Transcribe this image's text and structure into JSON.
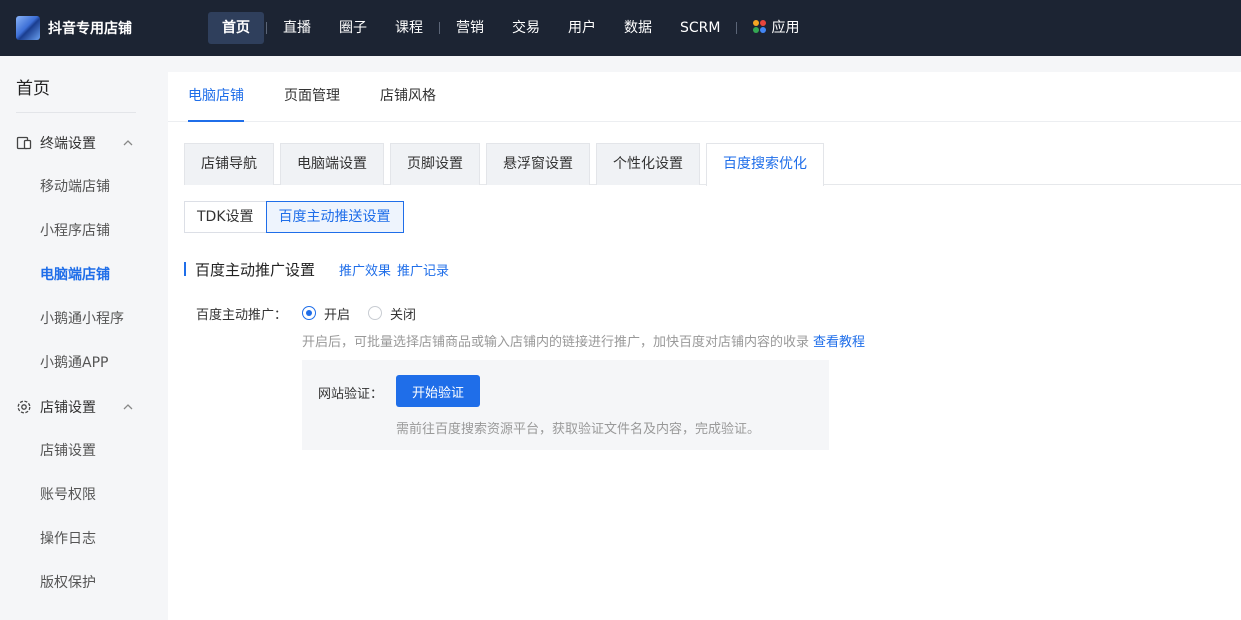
{
  "brand": {
    "name": "抖音专用店铺"
  },
  "topnav": {
    "items": [
      "首页",
      "直播",
      "圈子",
      "课程",
      "营销",
      "交易",
      "用户",
      "数据",
      "SCRM",
      "应用"
    ],
    "active": "首页"
  },
  "sidebar": {
    "title": "首页",
    "groups": [
      {
        "label": "终端设置",
        "items": [
          "移动端店铺",
          "小程序店铺",
          "电脑端店铺",
          "小鹅通小程序",
          "小鹅通APP"
        ]
      },
      {
        "label": "店铺设置",
        "items": [
          "店铺设置",
          "账号权限",
          "操作日志",
          "版权保护"
        ]
      }
    ],
    "active_item": "电脑端店铺"
  },
  "tabs": {
    "items": [
      "电脑店铺",
      "页面管理",
      "店铺风格"
    ],
    "active": "电脑店铺"
  },
  "subtabs": {
    "items": [
      "店铺导航",
      "电脑端设置",
      "页脚设置",
      "悬浮窗设置",
      "个性化设置",
      "百度搜索优化"
    ],
    "active": "百度搜索优化"
  },
  "segment": {
    "items": [
      "TDK设置",
      "百度主动推送设置"
    ],
    "active": "百度主动推送设置"
  },
  "section": {
    "title": "百度主动推广设置",
    "links": [
      "推广效果",
      "推广记录"
    ]
  },
  "form": {
    "label": "百度主动推广：",
    "options": [
      "开启",
      "关闭"
    ],
    "selected": "开启",
    "hint": "开启后，可批量选择店铺商品或输入店铺内的链接进行推广，加快百度对店铺内容的收录",
    "hint_link": "查看教程"
  },
  "verify": {
    "label": "网站验证：",
    "button": "开始验证",
    "hint": "需前往百度搜索资源平台，获取验证文件名及内容，完成验证。"
  },
  "colors": {
    "accent": "#1f6ee9",
    "topbar": "#1c2433"
  }
}
